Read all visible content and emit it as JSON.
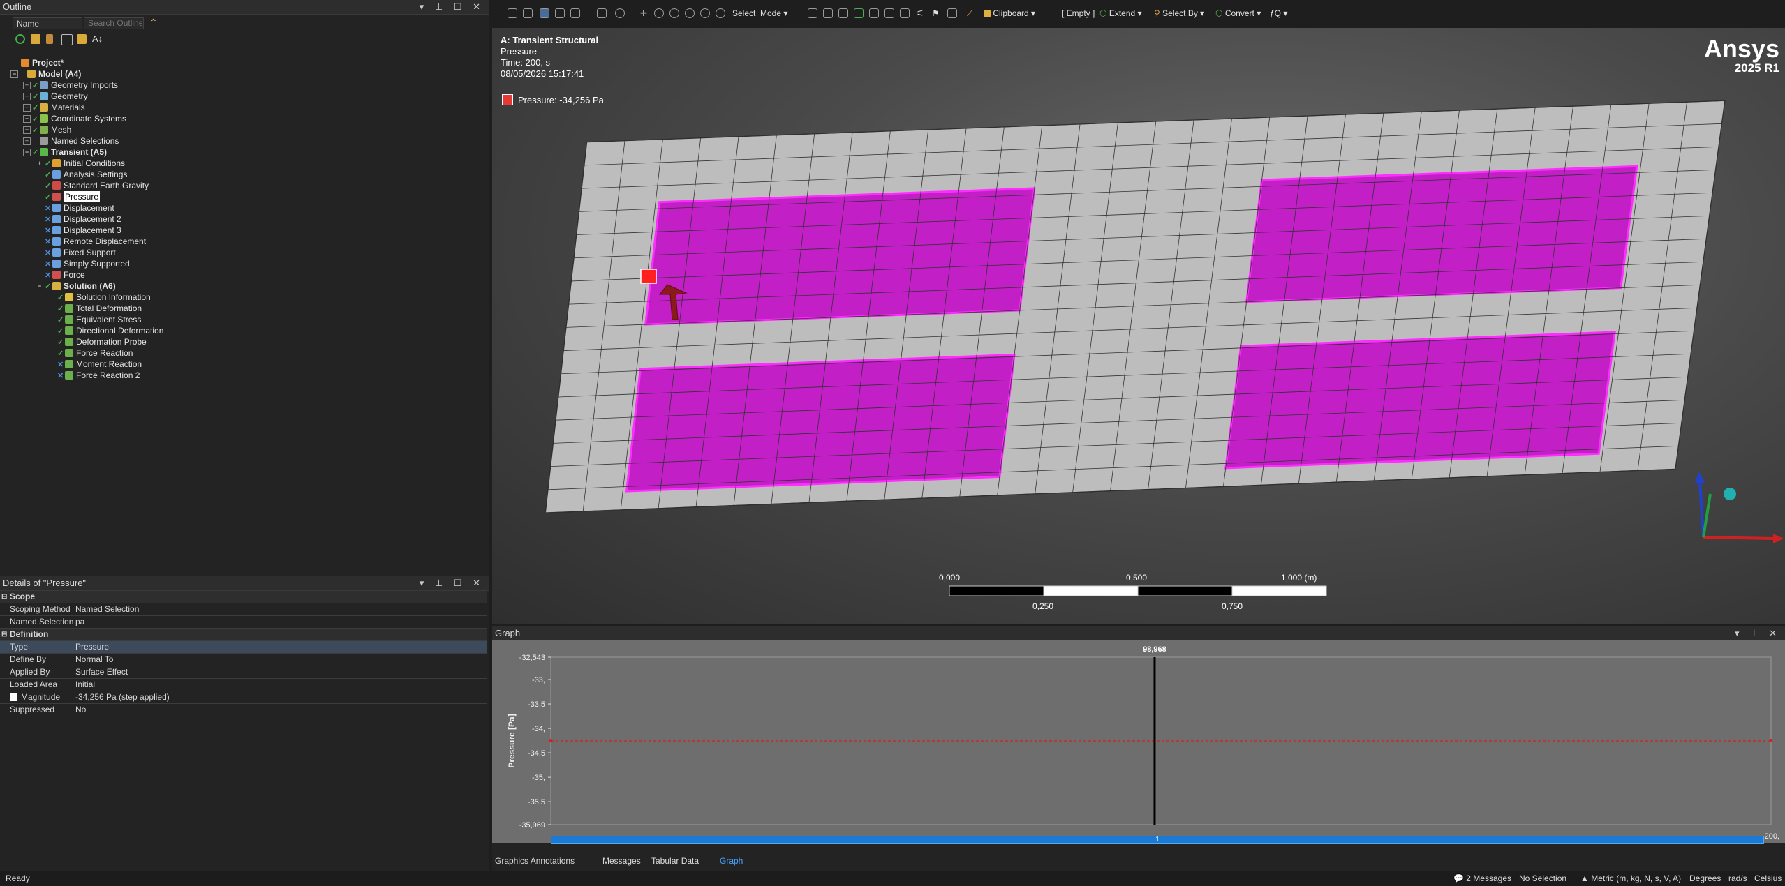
{
  "outline": {
    "title": "Outline",
    "filter_select": "Name",
    "search_placeholder": "Search Outline",
    "tree": [
      {
        "label": "Project*",
        "bold": true,
        "indent": 0,
        "expand": "",
        "icon": "#e68a2e",
        "check": ""
      },
      {
        "label": "Model (A4)",
        "bold": true,
        "indent": 1,
        "expand": "−",
        "icon": "#d9a93a",
        "check": ""
      },
      {
        "label": "Geometry Imports",
        "indent": 3,
        "expand": "+",
        "icon": "#7aa0c8",
        "check": "✓"
      },
      {
        "label": "Geometry",
        "indent": 3,
        "expand": "+",
        "icon": "#6bb0d8",
        "check": "✓"
      },
      {
        "label": "Materials",
        "indent": 3,
        "expand": "+",
        "icon": "#d6b043",
        "check": "✓"
      },
      {
        "label": "Coordinate Systems",
        "indent": 3,
        "expand": "+",
        "icon": "#8bc34a",
        "check": "✓"
      },
      {
        "label": "Mesh",
        "indent": 3,
        "expand": "+",
        "icon": "#7fb24a",
        "check": "✓"
      },
      {
        "label": "Named Selections",
        "indent": 3,
        "expand": "+",
        "icon": "#9a9a9a",
        "check": ""
      },
      {
        "label": "Transient (A5)",
        "bold": true,
        "indent": 3,
        "expand": "−",
        "icon": "#5ab84a",
        "check": "✓"
      },
      {
        "label": "Initial Conditions",
        "indent": 5,
        "expand": "+",
        "icon": "#e0a030",
        "check": "✓"
      },
      {
        "label": "Analysis Settings",
        "indent": 5,
        "expand": "",
        "icon": "#6aa0e0",
        "check": "✓"
      },
      {
        "label": "Standard Earth Gravity",
        "indent": 5,
        "expand": "",
        "icon": "#d04a4a",
        "check": "✓"
      },
      {
        "label": "Pressure",
        "indent": 5,
        "expand": "",
        "icon": "#d05050",
        "check": "✓",
        "selected": true
      },
      {
        "label": "Displacement",
        "indent": 5,
        "expand": "",
        "icon": "#6aa0e0",
        "check": "✕"
      },
      {
        "label": "Displacement 2",
        "indent": 5,
        "expand": "",
        "icon": "#6aa0e0",
        "check": "✕"
      },
      {
        "label": "Displacement 3",
        "indent": 5,
        "expand": "",
        "icon": "#6aa0e0",
        "check": "✕"
      },
      {
        "label": "Remote Displacement",
        "indent": 5,
        "expand": "",
        "icon": "#6aa0e0",
        "check": "✕"
      },
      {
        "label": "Fixed Support",
        "indent": 5,
        "expand": "",
        "icon": "#6aa0e0",
        "check": "✕"
      },
      {
        "label": "Simply Supported",
        "indent": 5,
        "expand": "",
        "icon": "#6aa0e0",
        "check": "✕"
      },
      {
        "label": "Force",
        "indent": 5,
        "expand": "",
        "icon": "#d05050",
        "check": "✕"
      },
      {
        "label": "Solution (A6)",
        "bold": true,
        "indent": 5,
        "expand": "−",
        "icon": "#d6b043",
        "check": "✓"
      },
      {
        "label": "Solution Information",
        "indent": 7,
        "expand": "",
        "icon": "#e0c040",
        "check": "✓"
      },
      {
        "label": "Total Deformation",
        "indent": 7,
        "expand": "",
        "icon": "#6bb04a",
        "check": "✓"
      },
      {
        "label": "Equivalent Stress",
        "indent": 7,
        "expand": "",
        "icon": "#6bb04a",
        "check": "✓"
      },
      {
        "label": "Directional Deformation",
        "indent": 7,
        "expand": "",
        "icon": "#6bb04a",
        "check": "✓"
      },
      {
        "label": "Deformation Probe",
        "indent": 7,
        "expand": "",
        "icon": "#6bb04a",
        "check": "✓"
      },
      {
        "label": "Force Reaction",
        "indent": 7,
        "expand": "",
        "icon": "#6bb04a",
        "check": "✓"
      },
      {
        "label": "Moment Reaction",
        "indent": 7,
        "expand": "",
        "icon": "#6bb04a",
        "check": "✕"
      },
      {
        "label": "Force Reaction 2",
        "indent": 7,
        "expand": "",
        "icon": "#6bb04a",
        "check": "✕"
      }
    ]
  },
  "details": {
    "title": "Details of \"Pressure\"",
    "rows": [
      {
        "k": "Scope",
        "v": "",
        "section": true
      },
      {
        "k": "Scoping Method",
        "v": "Named Selection"
      },
      {
        "k": "Named Selection",
        "v": "pa"
      },
      {
        "k": "Definition",
        "v": "",
        "section": true
      },
      {
        "k": "Type",
        "v": "Pressure",
        "hl": true
      },
      {
        "k": "Define By",
        "v": "Normal To"
      },
      {
        "k": "Applied By",
        "v": "Surface Effect"
      },
      {
        "k": "Loaded Area",
        "v": "Initial"
      },
      {
        "k": "Magnitude",
        "v": "-34,256 Pa  (step applied)",
        "box": true
      },
      {
        "k": "Suppressed",
        "v": "No"
      }
    ]
  },
  "toolbar": {
    "select": "Select",
    "mode": "Mode",
    "clipboard": "Clipboard",
    "empty": "[ Empty ]",
    "extend": "Extend",
    "select_by": "Select By",
    "convert": "Convert"
  },
  "viewport": {
    "analysis_title": "A: Transient Structural",
    "item": "Pressure",
    "time": "Time: 200, s",
    "date": "08/05/2026 15:17:41",
    "legend": "Pressure: -34,256 Pa",
    "brand": "Ansys",
    "version": "2025 R1",
    "scale_top": [
      "0,000",
      "0,500",
      "1,000 (m)"
    ],
    "scale_bottom": [
      "0,250",
      "0,750"
    ]
  },
  "graph": {
    "title": "Graph",
    "ylabel": "Pressure [Pa]",
    "yticks": [
      "-32,543",
      "-33,",
      "-33,5",
      "-34,",
      "-34,5",
      "-35,",
      "-35,5",
      "-35,969"
    ],
    "marker_label": "98,968",
    "x_end": "200,",
    "timeline_label": "1",
    "tabs": [
      "Graphics Annotations",
      "Messages",
      "Tabular Data",
      "Graph"
    ],
    "active_tab": "Graph"
  },
  "chart_data": {
    "type": "line",
    "title": "",
    "xlabel": "",
    "ylabel": "Pressure [Pa]",
    "ylim": [
      -35969,
      -32543
    ],
    "xlim": [
      0,
      200
    ],
    "series": [
      {
        "x": [
          0,
          200
        ],
        "values": [
          -34256,
          -34256
        ]
      }
    ],
    "marker_x": 98.968
  },
  "status": {
    "left": "Ready",
    "messages": "2 Messages",
    "selection": "No Selection",
    "units": "Metric (m, kg, N, s, V, A)",
    "angle": "Degrees",
    "rate": "rad/s",
    "temp": "Celsius"
  }
}
